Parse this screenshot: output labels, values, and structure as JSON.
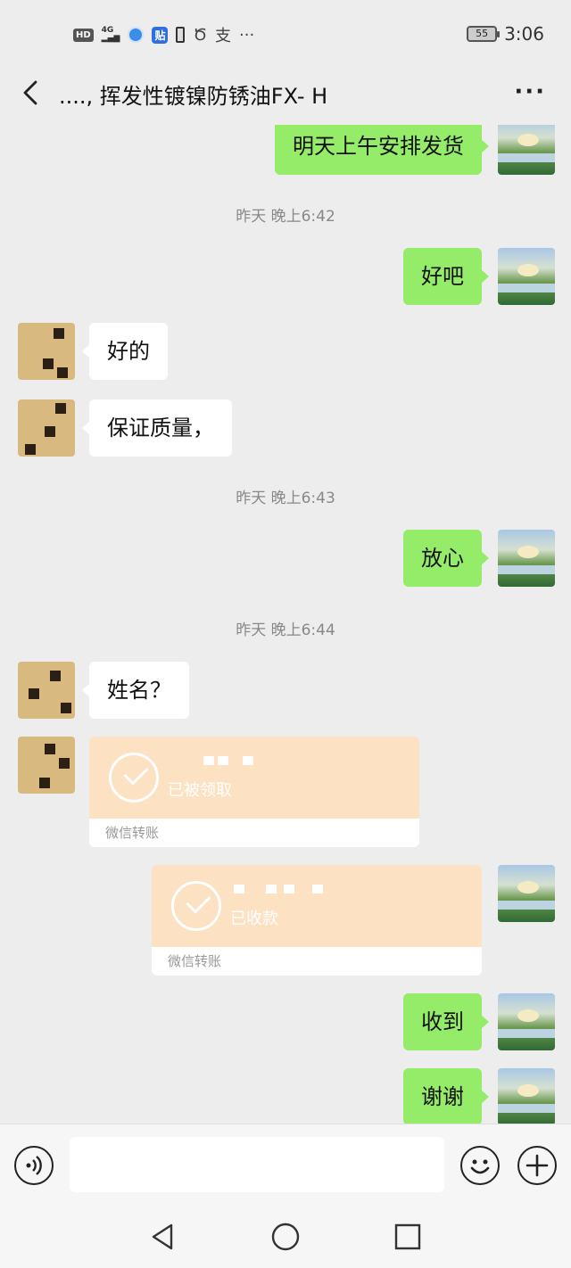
{
  "status_bar": {
    "left_icons": [
      "hd-icon",
      "signal-4g-icon",
      "globe-icon",
      "tie-app-icon",
      "battery-small-icon",
      "shield-icon",
      "zhi-icon",
      "more-dots"
    ],
    "hd_label": "HD",
    "net_label": "4G",
    "tie_label": "贴",
    "zhi_label": "支",
    "dots_label": "···",
    "battery_level": "55",
    "time": "3:06"
  },
  "nav": {
    "title": "....,  挥发性镀镍防锈油FX-  H",
    "more_label": "···"
  },
  "messages": {
    "m1": "明天上午安排发货",
    "t1": "昨天 晚上6:42",
    "m2": "好吧",
    "m3": "好的",
    "m4": "保证质量，",
    "t2": "昨天 晚上6:43",
    "m5": "放心",
    "t3": "昨天 晚上6:44",
    "m6": "姓名？",
    "transfer1": {
      "status": "已被领取",
      "label": "微信转账"
    },
    "transfer2": {
      "status": "已收款",
      "label": "微信转账"
    },
    "m7": "收到",
    "m8": "谢谢"
  },
  "input_bar": {
    "placeholder": "",
    "value": ""
  },
  "colors": {
    "self_bubble": "#95ec69",
    "other_bubble": "#ffffff",
    "transfer_bg": "#fde1c3",
    "background": "#ededed"
  }
}
